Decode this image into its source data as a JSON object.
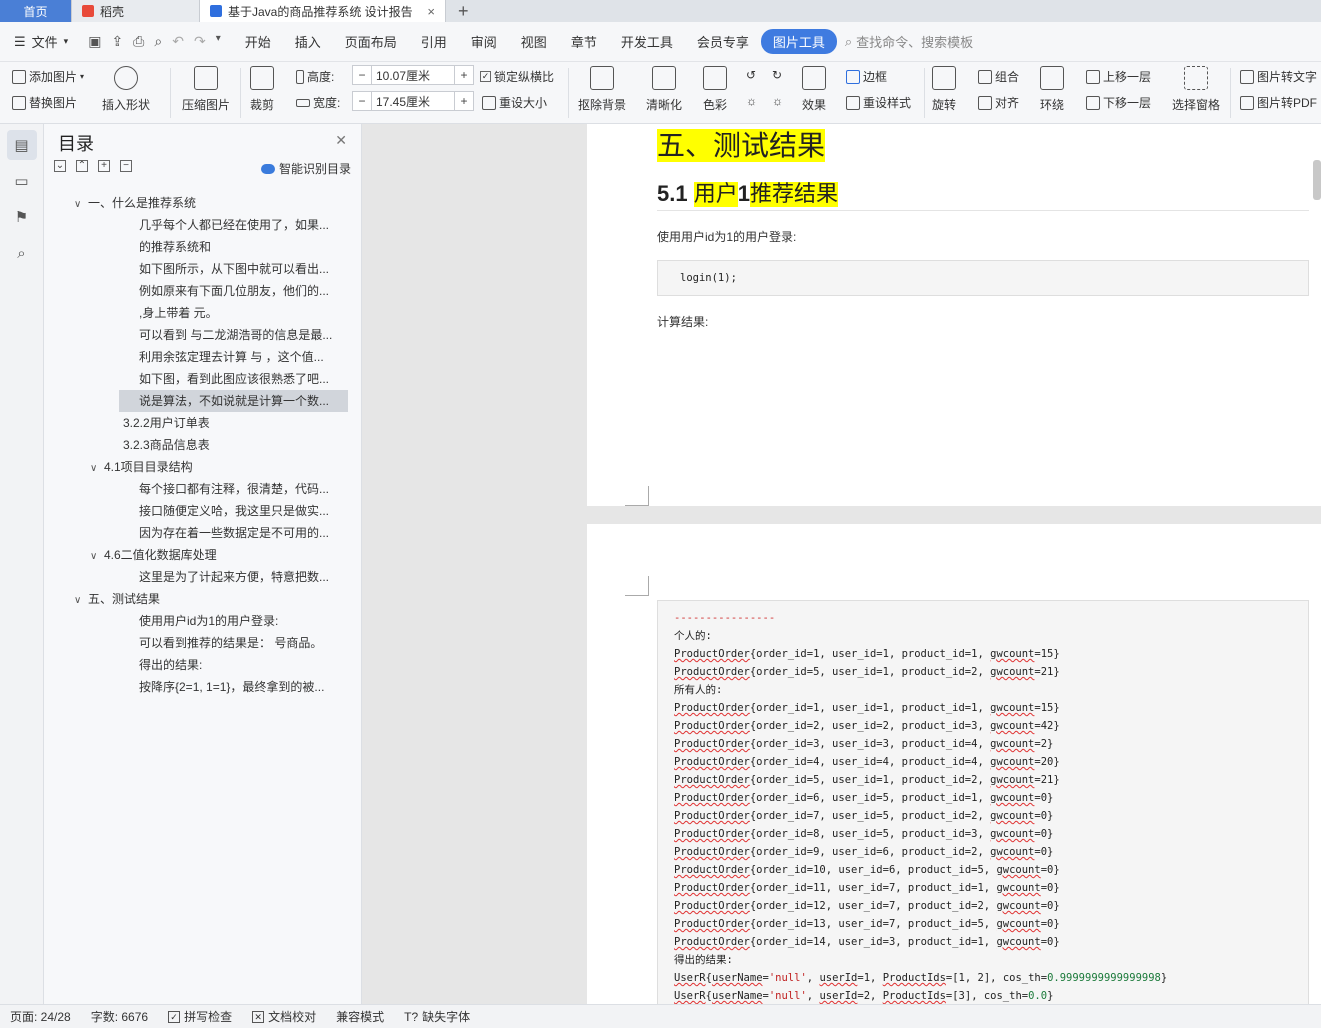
{
  "tabs": {
    "home": "首页",
    "daoke": "稻壳",
    "document": "基于Java的商品推荐系统 设计报告",
    "close_glyph": "×",
    "new_tab_glyph": "+"
  },
  "menubar": {
    "file": "文件",
    "items": [
      "开始",
      "插入",
      "页面布局",
      "引用",
      "审阅",
      "视图",
      "章节",
      "开发工具",
      "会员专享",
      "图片工具"
    ],
    "search_placeholder": "查找命令、搜索模板"
  },
  "ribbon": {
    "add_image": "添加图片",
    "replace_image": "替换图片",
    "insert_shape": "插入形状",
    "compress_image": "压缩图片",
    "crop": "裁剪",
    "height_label": "高度:",
    "height_value": "10.07厘米",
    "width_label": "宽度:",
    "width_value": "17.45厘米",
    "lock_ratio": "锁定纵横比",
    "reset_size": "重设大小",
    "remove_bg": "抠除背景",
    "sharpen": "清晰化",
    "color": "色彩",
    "effects": "效果",
    "border": "边框",
    "reset_style": "重设样式",
    "rotate": "旋转",
    "group": "组合",
    "align": "对齐",
    "wrap": "环绕",
    "bring_forward": "上移一层",
    "send_backward": "下移一层",
    "selection_pane": "选择窗格",
    "image_to_text": "图片转文字",
    "image_to_pdf": "图片转PDF",
    "minus": "−",
    "plus": "+"
  },
  "toc": {
    "title": "目录",
    "smart_detect": "智能识别目录",
    "items": [
      {
        "text": "一、什么是推荐系统",
        "level": 1,
        "caret": true
      },
      {
        "text": "几乎每个人都已经在使用了，如果...",
        "level": 4
      },
      {
        "text": "的推荐系统和",
        "level": 4
      },
      {
        "text": "如下图所示，从下图中就可以看出...",
        "level": 4
      },
      {
        "text": "例如原来有下面几位朋友，他们的...",
        "level": 4
      },
      {
        "text": ",身上带着 元。",
        "level": 4
      },
      {
        "text": "可以看到 与二龙湖浩哥的信息是最...",
        "level": 4
      },
      {
        "text": "利用余弦定理去计算 与 ，这个值...",
        "level": 4
      },
      {
        "text": "如下图，看到此图应该很熟悉了吧...",
        "level": 4
      },
      {
        "text": "说是算法，不如说就是计算一个数...",
        "level": 4,
        "selected": true
      },
      {
        "text": "3.2.2用户订单表",
        "level": 3
      },
      {
        "text": "3.2.3商品信息表",
        "level": 3
      },
      {
        "text": "4.1项目目录结构",
        "level": 2,
        "caret": true
      },
      {
        "text": "每个接口都有注释，很清楚，代码...",
        "level": 4
      },
      {
        "text": "接口随便定义哈，我这里只是做实...",
        "level": 4
      },
      {
        "text": "因为存在着一些数据定是不可用的...",
        "level": 4
      },
      {
        "text": "4.6二值化数据库处理",
        "level": 2,
        "caret": true
      },
      {
        "text": "这里是为了计起来方便，特意把数...",
        "level": 4
      },
      {
        "text": "五、测试结果",
        "level": 1,
        "caret": true
      },
      {
        "text": "使用用户id为1的用户登录:",
        "level": 4
      },
      {
        "text": "可以看到推荐的结果是： 号商品。",
        "level": 4
      },
      {
        "text": "得出的结果:",
        "level": 4
      },
      {
        "text": "按降序{2=1, 1=1}，最终拿到的被...",
        "level": 4
      }
    ]
  },
  "document": {
    "heading1": "五、测试结果",
    "heading2_num_a": "5.1 ",
    "heading2_user": "用户",
    "heading2_num_b": "1",
    "heading2_rest": "推荐结果",
    "login_text": "使用用户id为1的用户登录:",
    "login_code": "login(1);",
    "calc_text": "计算结果:",
    "code_dash": "----------------",
    "personal_label": "个人的:",
    "all_label": "所有人的:",
    "result_label": "得出的结果:",
    "personal_orders": [
      {
        "order_id": 1,
        "user_id": 1,
        "product_id": 1,
        "gwcount": 15
      },
      {
        "order_id": 5,
        "user_id": 1,
        "product_id": 2,
        "gwcount": 21
      }
    ],
    "all_orders": [
      {
        "order_id": 1,
        "user_id": 1,
        "product_id": 1,
        "gwcount": 15
      },
      {
        "order_id": 2,
        "user_id": 2,
        "product_id": 3,
        "gwcount": 42
      },
      {
        "order_id": 3,
        "user_id": 3,
        "product_id": 4,
        "gwcount": 2
      },
      {
        "order_id": 4,
        "user_id": 4,
        "product_id": 4,
        "gwcount": 20
      },
      {
        "order_id": 5,
        "user_id": 1,
        "product_id": 2,
        "gwcount": 21
      },
      {
        "order_id": 6,
        "user_id": 5,
        "product_id": 1,
        "gwcount": 0
      },
      {
        "order_id": 7,
        "user_id": 5,
        "product_id": 2,
        "gwcount": 0
      },
      {
        "order_id": 8,
        "user_id": 5,
        "product_id": 3,
        "gwcount": 0
      },
      {
        "order_id": 9,
        "user_id": 6,
        "product_id": 2,
        "gwcount": 0
      },
      {
        "order_id": 10,
        "user_id": 6,
        "product_id": 5,
        "gwcount": 0
      },
      {
        "order_id": 11,
        "user_id": 7,
        "product_id": 1,
        "gwcount": 0
      },
      {
        "order_id": 12,
        "user_id": 7,
        "product_id": 2,
        "gwcount": 0
      },
      {
        "order_id": 13,
        "user_id": 7,
        "product_id": 5,
        "gwcount": 0
      },
      {
        "order_id": 14,
        "user_id": 3,
        "product_id": 1,
        "gwcount": 0
      }
    ],
    "results": [
      {
        "userName": "'null'",
        "userId": 1,
        "ProductIds": "[1, 2]",
        "cos_th": "0.9999999999999998"
      },
      {
        "userName": "'null'",
        "userId": 2,
        "ProductIds": "[3]",
        "cos_th": "0.0"
      }
    ]
  },
  "status": {
    "page": "页面: 24/28",
    "words": "字数: 6676",
    "spell": "拼写检查",
    "proof": "文档校对",
    "compat": "兼容模式",
    "missing_font": "缺失字体"
  }
}
